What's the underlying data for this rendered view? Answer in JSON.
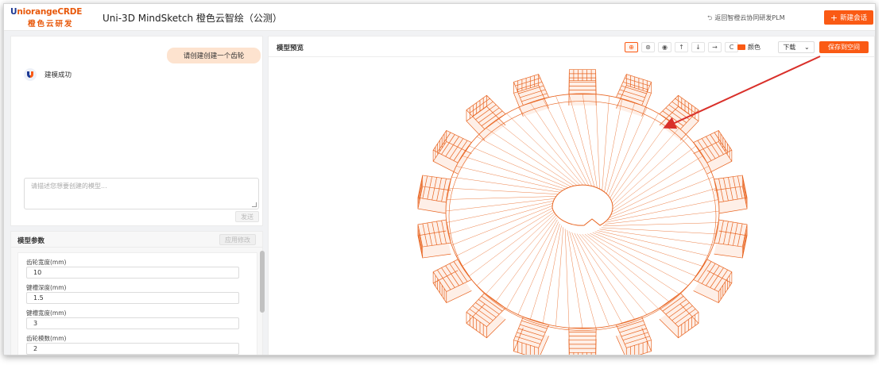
{
  "header": {
    "logo_brand": "UniorangeCRDE",
    "logo_brand_prefix": "U",
    "logo_brand_rest": "niorangeCRDE",
    "logo_subtitle": "橙色云研发",
    "app_title": "Uni-3D MindSketch 橙色云智绘（公测）",
    "back_link": "返回智橙云协同研发PLM",
    "new_session_label": "新建会话"
  },
  "chat": {
    "user_message": "请创建创建一个齿轮",
    "bot_message": "建模成功",
    "input_placeholder": "请描述您想要创建的模型...",
    "send_label": "发送"
  },
  "params": {
    "title": "模型参数",
    "apply_label": "应用修改",
    "fields": [
      {
        "label": "齿轮宽度(mm)",
        "value": "10"
      },
      {
        "label": "键槽深度(mm)",
        "value": "1.5"
      },
      {
        "label": "键槽宽度(mm)",
        "value": "3"
      },
      {
        "label": "齿轮模数(mm)",
        "value": "2"
      }
    ]
  },
  "preview": {
    "title": "模型预览",
    "tools": [
      {
        "name": "wireframe-view-icon",
        "glyph": "⊕",
        "active": true
      },
      {
        "name": "solid-view-icon",
        "glyph": "⊛",
        "active": false
      },
      {
        "name": "eye-view-icon",
        "glyph": "◉",
        "active": false
      },
      {
        "name": "arrow-up-icon",
        "glyph": "↑",
        "active": false
      },
      {
        "name": "arrow-down-icon",
        "glyph": "↓",
        "active": false
      },
      {
        "name": "arrow-right-icon",
        "glyph": "→",
        "active": false
      },
      {
        "name": "reset-icon",
        "glyph": "C",
        "active": false
      }
    ],
    "color_label": "颜色",
    "download_label": "下载",
    "save_label": "保存到空间"
  },
  "colors": {
    "accent": "#fa5a14",
    "mesh": "#e8631f",
    "annotation": "#d9302a"
  },
  "gear": {
    "teeth": 18
  }
}
